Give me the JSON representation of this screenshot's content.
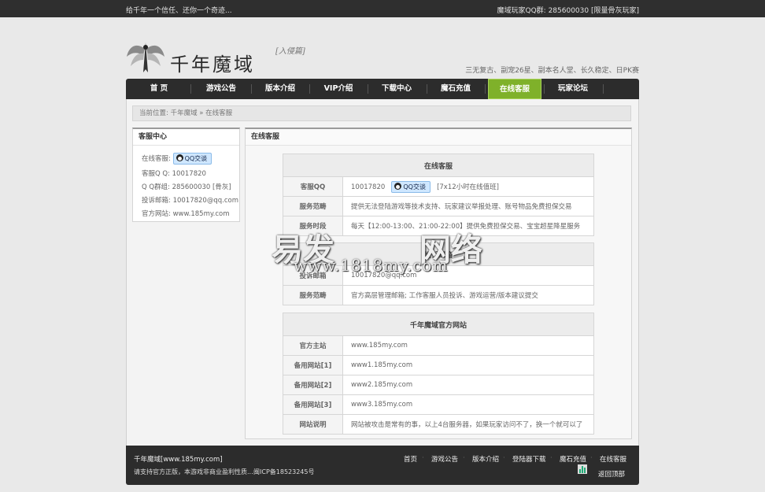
{
  "topbar": {
    "left_text": "给千年一个信任、还你一个奇迹...",
    "right_text": "魔域玩家QQ群: 285600030 [限量骨灰玩家]"
  },
  "logo": {
    "name": "千年魔域",
    "subtitle": "[入侵篇]"
  },
  "slogan": "三无复古、副宠26星、副本名人堂、长久稳定、日PK赛",
  "nav": {
    "items": [
      {
        "label": "首 页"
      },
      {
        "label": "游戏公告"
      },
      {
        "label": "版本介绍"
      },
      {
        "label": "VIP介绍"
      },
      {
        "label": "下载中心"
      },
      {
        "label": "魔石充值"
      },
      {
        "label": "在线客服",
        "active": true
      },
      {
        "label": "玩家论坛"
      }
    ],
    "active_color": "#7fb12a"
  },
  "breadcrumb": "当前位置: 千年魔域 » 在线客服",
  "sidebar": {
    "title": "客服中心",
    "online_label": "在线客服:",
    "qq_button": "QQ交谈",
    "qq_line": "客服Q Q: 10017820",
    "group_line": "Q Q群组: 285600030 [骨灰]",
    "email_line": "投诉邮箱: 10017820@qq.com",
    "site_line": "官方网站: www.185my.com"
  },
  "main": {
    "title": "在线客服",
    "table1": {
      "caption": "在线客服",
      "rows": [
        {
          "label": "客服QQ",
          "qq": "10017820",
          "button": "QQ交谈",
          "note": "[7x12小时在线值班]"
        },
        {
          "label": "服务范畴",
          "value": "提供无法登陆游戏等技术支持、玩家建议举报处理、账号物品免费担保交易"
        },
        {
          "label": "服务时段",
          "value": "每天【12:00-13:00、21:00-22:00】提供免费担保交易、宝宝超星降星服务"
        }
      ]
    },
    "table2": {
      "caption": "投诉邮箱",
      "rows": [
        {
          "label": "投诉邮箱",
          "value": "10017820@qq.com"
        },
        {
          "label": "服务范畴",
          "value": "官方高层管理邮箱; 工作客服人员投诉、游戏运营/版本建议提交"
        }
      ]
    },
    "table3": {
      "caption": "千年魔域官方网站",
      "rows": [
        {
          "label": "官方主站",
          "value": "www.185my.com"
        },
        {
          "label": "备用网站[1]",
          "value": "www1.185my.com"
        },
        {
          "label": "备用网站[2]",
          "value": "www2.185my.com"
        },
        {
          "label": "备用网站[3]",
          "value": "www3.185my.com"
        },
        {
          "label": "网站说明",
          "value": "网站被攻击是常有的事，以上4台服务器，如果玩家访问不了，换一个就可以了"
        }
      ]
    }
  },
  "watermark": {
    "big1": "易发",
    "big2": "网络",
    "small": "www.1818my.com"
  },
  "footer": {
    "site": "千年魔域[www.185my.com]",
    "notice": "请支持官方正版，本游戏非商业盈利性质...",
    "icp": "闽ICP备18523245号",
    "links": [
      "首页",
      "游戏公告",
      "版本介绍",
      "登陆器下载",
      "魔石充值",
      "在线客服"
    ],
    "back_top": "返回顶部"
  }
}
